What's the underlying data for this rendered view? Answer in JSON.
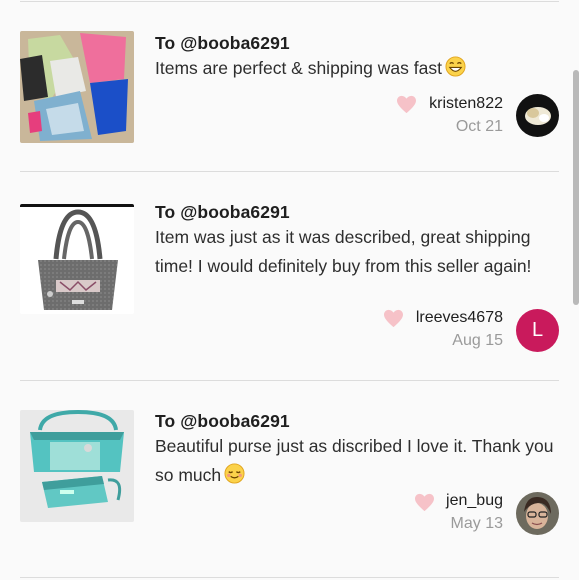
{
  "reviews": [
    {
      "to": "To @booba6291",
      "text": "Items are perfect & shipping was fast",
      "emoji_icon": "grinning-face-icon",
      "username": "kristen822",
      "date": "Oct 21",
      "avatar_icon": "user-photo-avatar"
    },
    {
      "to": "To @booba6291",
      "text": "Item was just as it was described, great shipping time! I would definitely buy from this seller again!",
      "username": "lreeves4678",
      "date": "Aug 15",
      "avatar_letter": "L",
      "avatar_color": "#c91a5c"
    },
    {
      "to": "To @booba6291",
      "text": "Beautiful purse just as discribed I love it. Thank you so much",
      "emoji_icon": "relieved-face-icon",
      "username": "jen_bug",
      "date": "May 13",
      "avatar_icon": "user-photo-avatar"
    }
  ],
  "colors": {
    "heart": "#f6c2c8",
    "date": "#9a9a9a",
    "divider": "#dcdcdc"
  }
}
